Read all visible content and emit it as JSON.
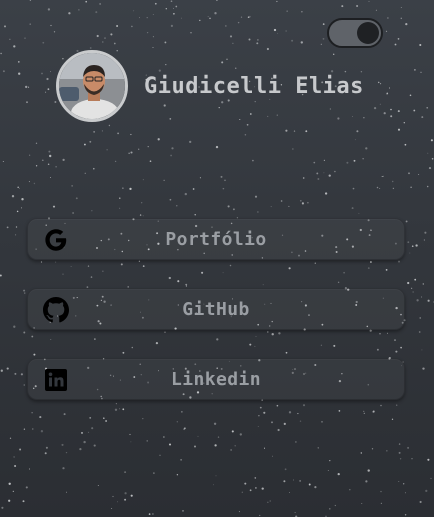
{
  "theme_toggle": {
    "state": "on"
  },
  "profile": {
    "name": "Giudicelli Elias"
  },
  "links": [
    {
      "label": "Portfólio",
      "icon": "google-icon"
    },
    {
      "label": "GitHub",
      "icon": "github-icon"
    },
    {
      "label": "Linkedin",
      "icon": "linkedin-icon"
    }
  ],
  "colors": {
    "background": "#33373d",
    "text": "#c7c9cc",
    "button_text": "#9a9ea3"
  }
}
